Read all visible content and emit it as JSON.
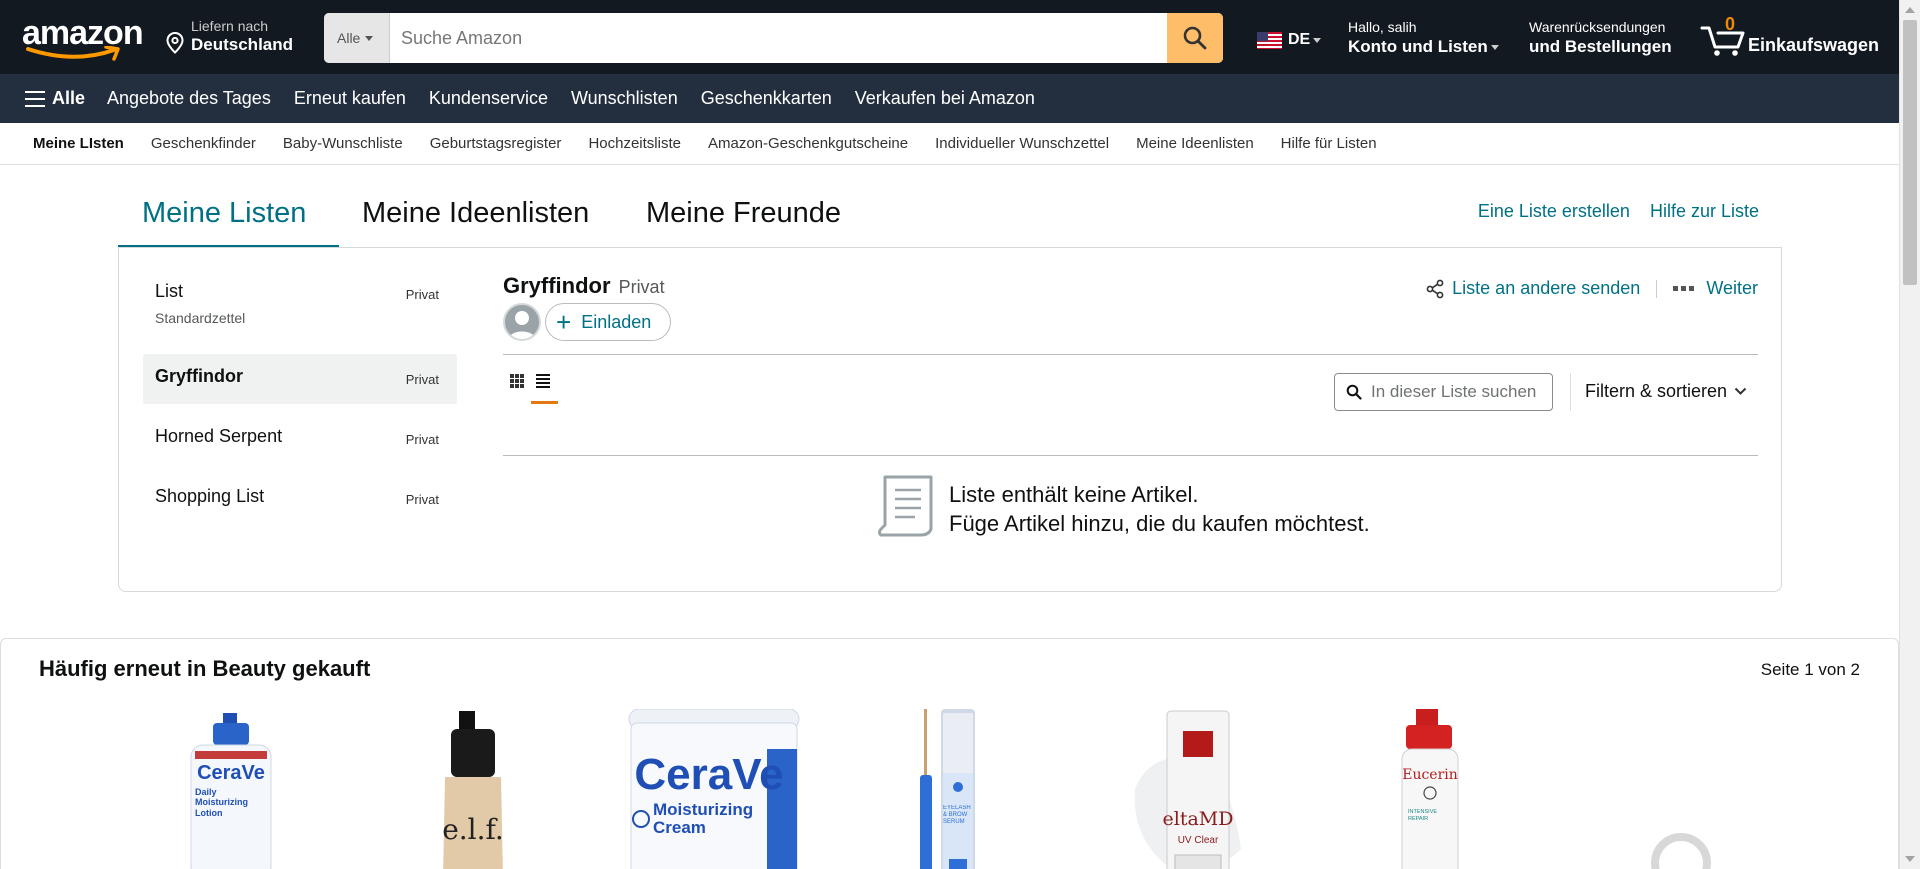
{
  "header": {
    "deliver_line1": "Liefern nach",
    "deliver_line2": "Deutschland",
    "search_category": "Alle",
    "search_placeholder": "Suche Amazon",
    "language": "DE",
    "account_line1": "Hallo, salih",
    "account_line2": "Konto und Listen",
    "orders_line1": "Warenrücksendungen",
    "orders_line2": "und Bestellungen",
    "cart_count": "0",
    "cart_label": "Einkaufswagen",
    "logo": "amazon"
  },
  "main_nav": {
    "all_label": "Alle",
    "items": [
      "Angebote des Tages",
      "Erneut kaufen",
      "Kundenservice",
      "Wunschlisten",
      "Geschenkkarten",
      "Verkaufen bei Amazon"
    ]
  },
  "sub_nav": {
    "items": [
      "Meine LIsten",
      "Geschenkfinder",
      "Baby-Wunschliste",
      "Geburtstagsregister",
      "Hochzeitsliste",
      "Amazon-Geschenkgutscheine",
      "Individueller Wunschzettel",
      "Meine Ideenlisten",
      "Hilfe für Listen"
    ]
  },
  "tabs": {
    "items": [
      "Meine Listen",
      "Meine Ideenlisten",
      "Meine Freunde"
    ],
    "active": "Meine Listen",
    "create_list": "Eine Liste erstellen",
    "help": "Hilfe zur Liste"
  },
  "lists": [
    {
      "name": "List",
      "privacy": "Privat",
      "subtitle": "Standardzettel"
    },
    {
      "name": "Gryffindor",
      "privacy": "Privat"
    },
    {
      "name": "Horned Serpent",
      "privacy": "Privat"
    },
    {
      "name": "Shopping List",
      "privacy": "Privat"
    }
  ],
  "detail": {
    "title": "Gryffindor",
    "privacy": "Privat",
    "share": "Liste an andere senden",
    "more": "Weiter",
    "invite": "Einladen",
    "search_placeholder": "In dieser Liste suchen",
    "filter": "Filtern & sortieren",
    "empty_line1": "Liste enthält keine Artikel.",
    "empty_line2": "Füge Artikel hinzu, die du kaufen möchtest."
  },
  "reco": {
    "title": "Häufig erneut in Beauty gekauft",
    "page": "Seite 1 von 2",
    "products": [
      {
        "brand": "CeraVe",
        "text": "Daily Moisturizing Lotion"
      },
      {
        "brand": "e.l.f."
      },
      {
        "brand": "CeraVe",
        "text": "Moisturizing Cream"
      },
      {
        "brand": "",
        "text": "EYELASH & BROW SERUM"
      },
      {
        "brand": "eltaMD",
        "text": "UV Clear"
      },
      {
        "brand": "Eucerin",
        "text": "INTENSIVE REPAIR"
      }
    ]
  },
  "colors": {
    "nav_dark": "#131921",
    "nav_main": "#232f3e",
    "accent_orange": "#febd69",
    "link_teal": "#007185",
    "cart_count": "#f08804"
  }
}
